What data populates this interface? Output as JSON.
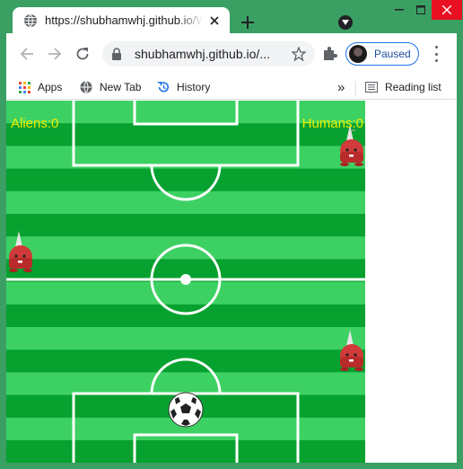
{
  "tab": {
    "title": "https://shubhamwhj.github.io/W",
    "icon": "globe-icon"
  },
  "toolbar": {
    "url": "shubhamwhj.github.io/...",
    "profile_label": "Paused"
  },
  "bookmarks": {
    "items": [
      {
        "label": "Apps",
        "icon": "apps-grid-icon"
      },
      {
        "label": "New Tab",
        "icon": "globe-icon"
      },
      {
        "label": "History",
        "icon": "history-icon"
      }
    ],
    "overflow": "»",
    "reading_list": "Reading list"
  },
  "game": {
    "aliens_score": "Aliens:0",
    "humans_score": "Humans:0",
    "score_color": "#f0f000",
    "grass_light": "#3dd163",
    "grass_dark": "#06a12f",
    "line_color": "#ffffff",
    "alien_color": "#d13a3a"
  },
  "colors": {
    "frame": "#3a9f63",
    "close_red": "#e81123",
    "accent_blue": "#1a73e8"
  }
}
